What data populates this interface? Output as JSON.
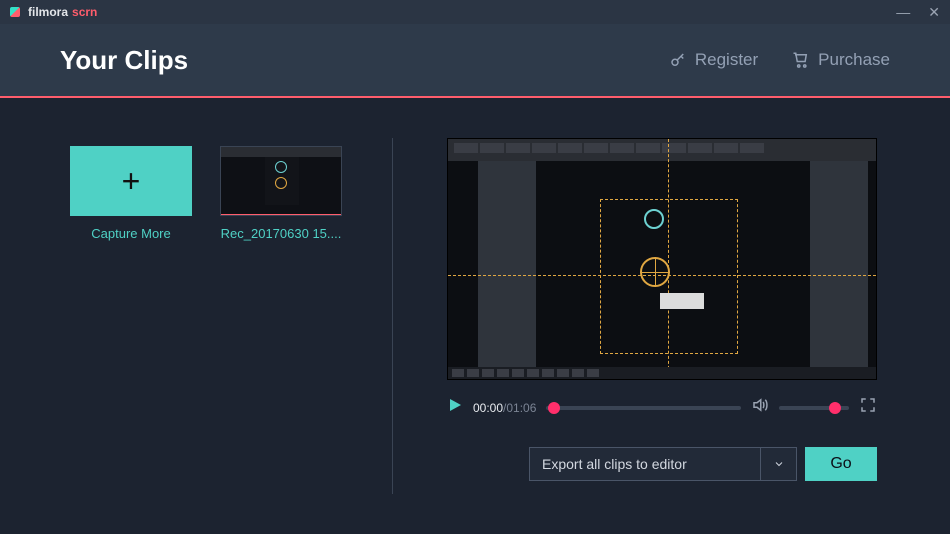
{
  "app": {
    "brand_main": "filmora",
    "brand_sub": "scrn"
  },
  "window_controls": {
    "minimize": "—",
    "close": "✕"
  },
  "header": {
    "title": "Your Clips",
    "register_label": "Register",
    "purchase_label": "Purchase"
  },
  "clips": {
    "capture_more_label": "Capture More",
    "items": [
      {
        "name": "Rec_20170630 15...."
      }
    ]
  },
  "player": {
    "current_time": "00:00",
    "total_time": "01:06",
    "seek_pct": 4,
    "volume_pct": 80
  },
  "export": {
    "selected": "Export all clips to editor",
    "go_label": "Go"
  },
  "colors": {
    "accent_teal": "#4fd1c5",
    "accent_pink": "#ff5d6c",
    "knob": "#ff2f6b"
  }
}
